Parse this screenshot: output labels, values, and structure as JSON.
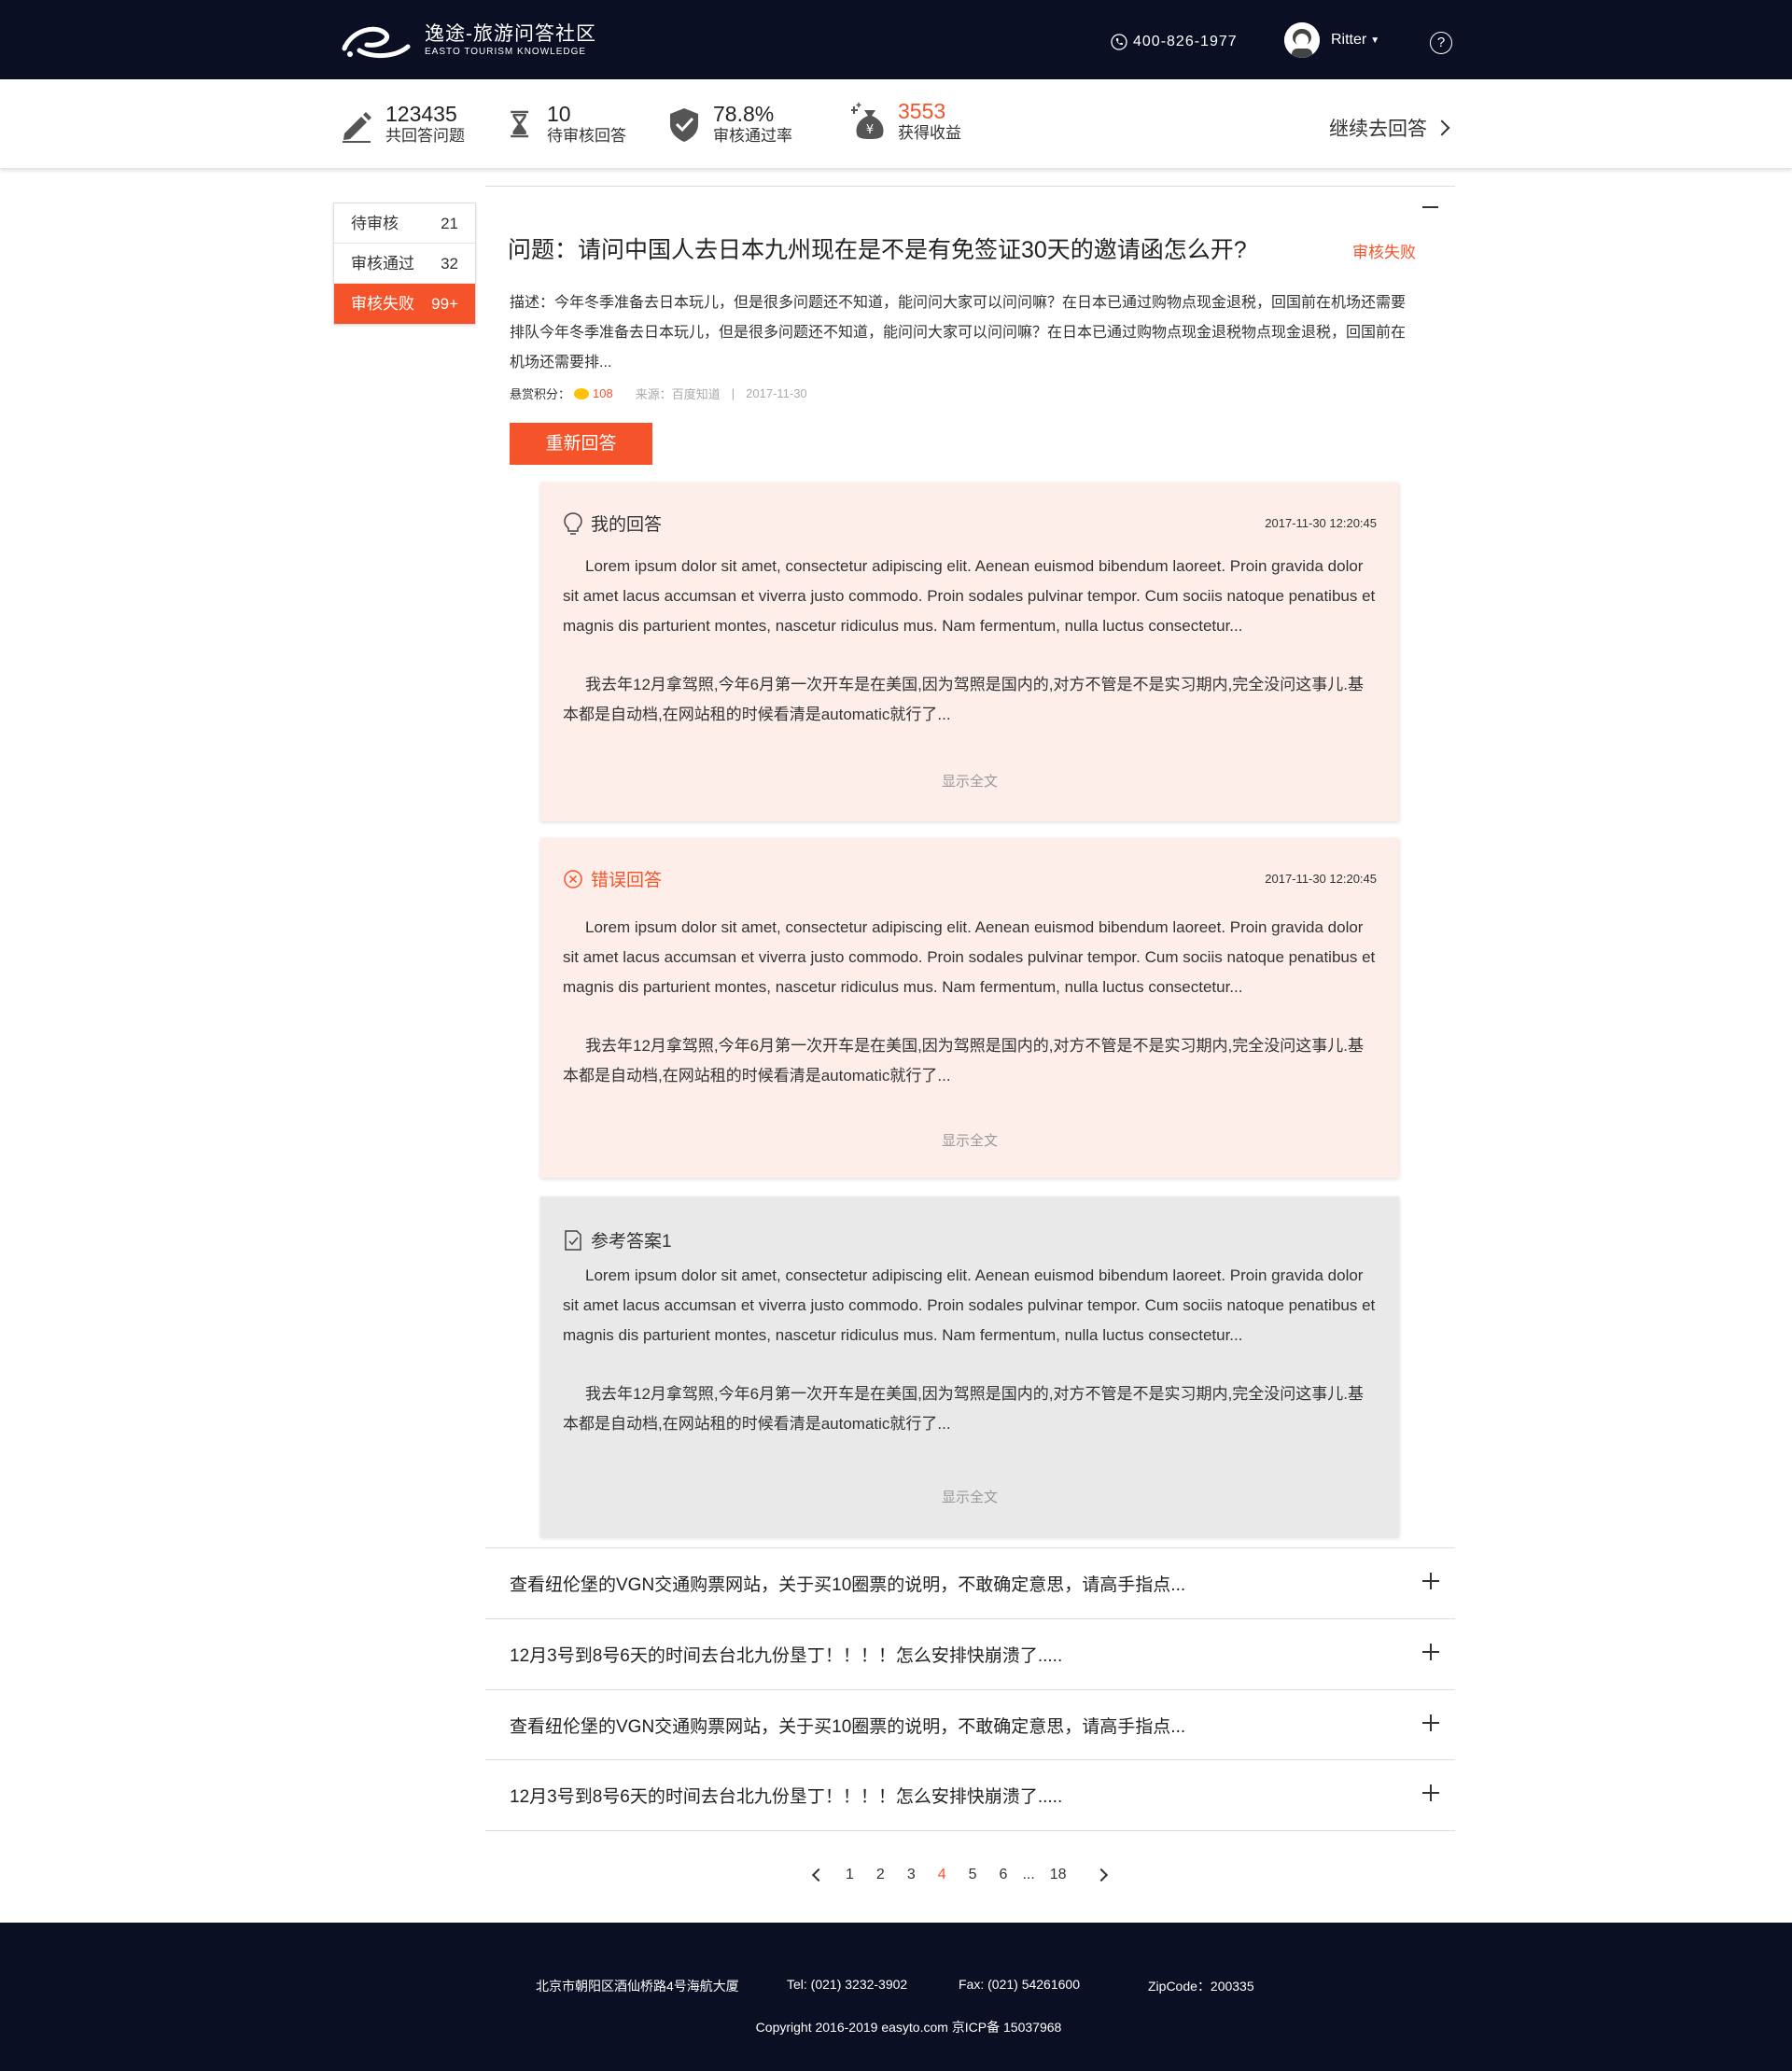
{
  "header": {
    "logo_title": "逸途-旅游问答社区",
    "logo_subtitle": "EASTO TOURISM KNOWLEDGE",
    "phone": "400-826-1977",
    "username": "Ritter",
    "help_glyph": "?"
  },
  "stats": [
    {
      "value": "123435",
      "label": "共回答问题",
      "icon": "pen-icon"
    },
    {
      "value": "10",
      "label": "待审核回答",
      "icon": "hourglass-icon"
    },
    {
      "value": "78.8%",
      "label": "审核通过率",
      "icon": "shield-check-icon"
    },
    {
      "value": "3553",
      "label": "获得收益",
      "icon": "money-bag-icon"
    }
  ],
  "continue_label": "继续去回答",
  "filters": [
    {
      "label": "待审核",
      "count": "21"
    },
    {
      "label": "审核通过",
      "count": "32"
    },
    {
      "label": "审核失败",
      "count": "99+"
    }
  ],
  "question": {
    "title": "问题：请问中国人去日本九州现在是不是有免签证30天的邀请函怎么开?",
    "status": "审核失败",
    "description": "描述：今年冬季准备去日本玩儿，但是很多问题还不知道，能问问大家可以问问嘛？在日本已通过购物点现金退税，回国前在机场还需要排队今年冬季准备去日本玩儿，但是很多问题还不知道，能问问大家可以问问嘛？在日本已通过购物点现金退税物点现金退税，回国前在机场还需要排...",
    "reward_label": "悬赏积分：",
    "reward_points": "108",
    "source": "来源：百度知道",
    "meta_separator": "|",
    "date": "2017-11-30",
    "reanswer_label": "重新回答"
  },
  "cards": [
    {
      "title": "我的回答",
      "time": "2017-11-30 12:20:45",
      "p1": "Lorem ipsum dolor sit amet, consectetur adipiscing elit. Aenean euismod bibendum laoreet. Proin gravida dolor sit amet lacus accumsan et viverra justo commodo. Proin sodales pulvinar tempor. Cum sociis natoque penatibus et magnis dis parturient montes, nascetur ridiculus mus. Nam fermentum, nulla luctus consectetur...",
      "p2": "我去年12月拿驾照,今年6月第一次开车是在美国,因为驾照是国内的,对方不管是不是实习期内,完全没问这事儿.基本都是自动档,在网站租的时候看清是automatic就行了...",
      "more": "显示全文"
    },
    {
      "title": "错误回答",
      "time": "2017-11-30 12:20:45",
      "p1": "Lorem ipsum dolor sit amet, consectetur adipiscing elit. Aenean euismod bibendum laoreet. Proin gravida dolor sit amet lacus accumsan et viverra justo commodo. Proin sodales pulvinar tempor. Cum sociis natoque penatibus et magnis dis parturient montes, nascetur ridiculus mus. Nam fermentum, nulla luctus consectetur...",
      "p2": "我去年12月拿驾照,今年6月第一次开车是在美国,因为驾照是国内的,对方不管是不是实习期内,完全没问这事儿.基本都是自动档,在网站租的时候看清是automatic就行了...",
      "more": "显示全文"
    },
    {
      "title": "参考答案1",
      "p1": "Lorem ipsum dolor sit amet, consectetur adipiscing elit. Aenean euismod bibendum laoreet. Proin gravida dolor sit amet lacus accumsan et viverra justo commodo. Proin sodales pulvinar tempor. Cum sociis natoque penatibus et magnis dis parturient montes, nascetur ridiculus mus. Nam fermentum, nulla luctus consectetur...",
      "p2": "我去年12月拿驾照,今年6月第一次开车是在美国,因为驾照是国内的,对方不管是不是实习期内,完全没问这事儿.基本都是自动档,在网站租的时候看清是automatic就行了...",
      "more": "显示全文"
    }
  ],
  "question_list": [
    "查看纽伦堡的VGN交通购票网站，关于买10圈票的说明，不敢确定意思，请高手指点...",
    "12月3号到8号6天的时间去台北九份垦丁！！！！怎么安排快崩溃了.....",
    "查看纽伦堡的VGN交通购票网站，关于买10圈票的说明，不敢确定意思，请高手指点...",
    "12月3号到8号6天的时间去台北九份垦丁！！！！怎么安排快崩溃了....."
  ],
  "pagination": {
    "pages": [
      "1",
      "2",
      "3",
      "4",
      "5",
      "6",
      "...",
      "18"
    ],
    "current": "4"
  },
  "footer": {
    "address": "北京市朝阳区酒仙桥路4号海航大厦",
    "tel": "Tel: (021) 3232-3902",
    "fax": "Fax:  (021) 54261600",
    "zip": "ZipCode：200335",
    "copyright": "Copyright 2016-2019 easyto.com 京ICP备 15037968"
  },
  "colors": {
    "nav_bg": "#0b0f24",
    "accent": "#f5542a",
    "card_pink": "#fdeeea",
    "card_gray": "#e9e9e9"
  }
}
